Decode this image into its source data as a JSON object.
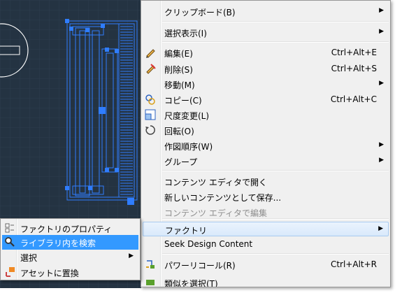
{
  "colors": {
    "canvas_bg": "#243342",
    "drawing": "#2f7dff",
    "grid": "#2d3d4d",
    "menu_bg": "#f0f0f0",
    "highlight": "#3399ff"
  },
  "context_menu": {
    "items": [
      {
        "label": "クリップボード(B)",
        "submenu": true,
        "icon": ""
      },
      {
        "label": "選択表示(I)",
        "submenu": true,
        "icon": ""
      },
      {
        "label": "編集(E)",
        "shortcut": "Ctrl+Alt+E",
        "icon": "pencil-icon"
      },
      {
        "label": "削除(S)",
        "shortcut": "Ctrl+Alt+S",
        "icon": "eraser-icon"
      },
      {
        "label": "移動(M)",
        "submenu": true,
        "icon": ""
      },
      {
        "label": "コピー(C)",
        "shortcut": "Ctrl+Alt+C",
        "icon": "copy-icon"
      },
      {
        "label": "尺度変更(L)",
        "icon": "scale-icon"
      },
      {
        "label": "回転(O)",
        "icon": "rotate-icon"
      },
      {
        "label": "作図順序(W)",
        "submenu": true,
        "icon": ""
      },
      {
        "label": "グループ",
        "submenu": true,
        "icon": ""
      },
      {
        "label": "コンテンツ エディタで開く",
        "icon": ""
      },
      {
        "label": "新しいコンテンツとして保存...",
        "icon": ""
      },
      {
        "label": "コンテンツ エディタで編集",
        "disabled": true,
        "icon": ""
      },
      {
        "label": "ファクトリ",
        "submenu": true,
        "highlighted": true,
        "icon": ""
      },
      {
        "label": "Seek Design Content",
        "icon": ""
      },
      {
        "label": "パワーリコール(R)",
        "shortcut": "Ctrl+Alt+R",
        "icon": "power-recall-icon"
      },
      {
        "label": "類似を選択(T)",
        "icon": "select-similar-icon"
      }
    ]
  },
  "factory_submenu": {
    "items": [
      {
        "label": "ファクトリのプロパティ",
        "icon": "factory-properties-icon"
      },
      {
        "label": "ライブラリ内を検索",
        "icon": "search-icon",
        "selected": true
      },
      {
        "label": "選択",
        "submenu": true
      },
      {
        "label": "アセットに置換",
        "icon": "replace-asset-icon"
      }
    ]
  }
}
